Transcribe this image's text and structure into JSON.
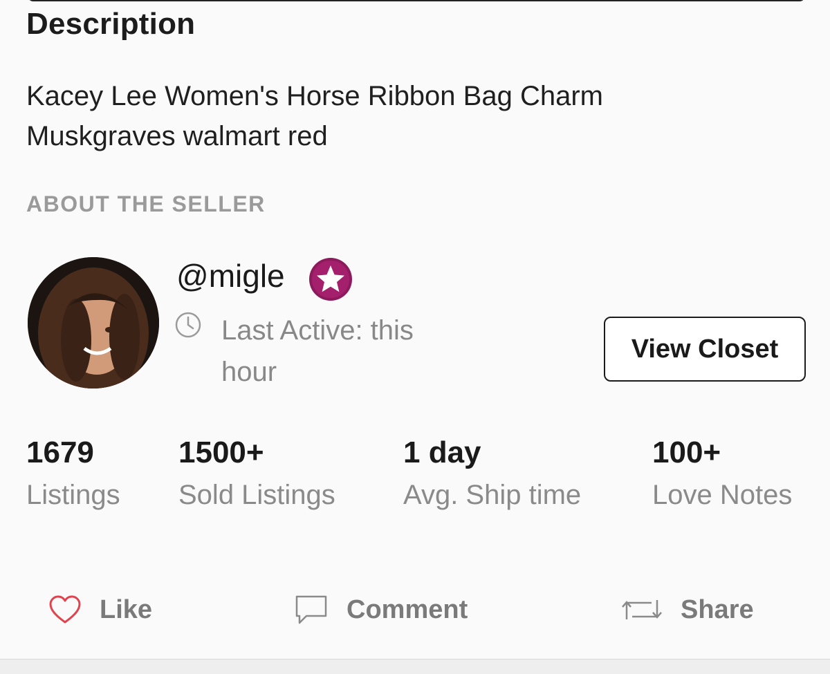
{
  "description": {
    "title": "Description",
    "text": "Kacey Lee Women's Horse Ribbon Bag Charm Muskgraves walmart red"
  },
  "seller": {
    "section_label": "ABOUT THE SELLER",
    "username": "@migle",
    "badge_icon": "star-badge-icon",
    "last_active": "Last Active: this hour",
    "view_closet_label": "View Closet"
  },
  "stats": [
    {
      "value": "1679",
      "label": "Listings"
    },
    {
      "value": "1500+",
      "label": "Sold Listings"
    },
    {
      "value": "1 day",
      "label": "Avg. Ship time"
    },
    {
      "value": "100+",
      "label": "Love Notes"
    }
  ],
  "actions": {
    "like": "Like",
    "comment": "Comment",
    "share": "Share"
  },
  "colors": {
    "badge": "#8e1a5e",
    "like_heart": "#e0434e",
    "text_muted": "#8a8a8a"
  }
}
